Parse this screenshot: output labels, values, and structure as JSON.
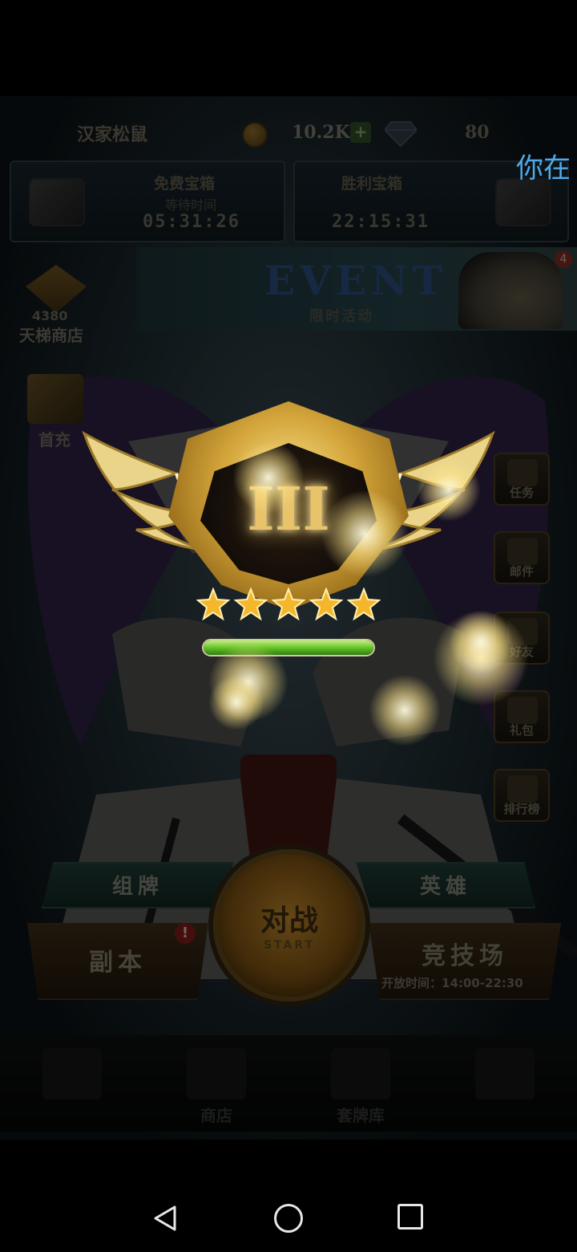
{
  "top_bar": {
    "player_name": "汉家松鼠",
    "coins": "10.2K",
    "add_label": "+",
    "gems": "80"
  },
  "notice": "你在",
  "chests": {
    "free": {
      "title": "免费宝箱",
      "subtitle": "等待时间",
      "time": "05:31:26"
    },
    "victory": {
      "title": "胜利宝箱",
      "time": "22:15:31"
    }
  },
  "event": {
    "title": "EVENT",
    "subtitle": "限时活动",
    "badge": "4"
  },
  "left_menu": {
    "ladder_count": "4380",
    "ladder_label": "天梯商店",
    "first_recharge_label": "首充"
  },
  "rank": {
    "numeral": "III",
    "stars_filled": 5,
    "stars_total": 5,
    "progress": 1.0,
    "progress_color": "#58b81e"
  },
  "right_menu": [
    {
      "label": "任务",
      "icon": "task-icon"
    },
    {
      "label": "邮件",
      "icon": "mail-icon"
    },
    {
      "label": "好友",
      "icon": "friends-icon"
    },
    {
      "label": "礼包",
      "icon": "gift-pack-icon"
    },
    {
      "label": "排行榜",
      "icon": "trophy-icon"
    }
  ],
  "controls": {
    "deck": "组牌",
    "hero": "英雄",
    "battle": "对战",
    "battle_sub": "START",
    "dungeon": "副本",
    "dungeon_alert": "!",
    "arena": "竞技场",
    "arena_time": "开放时间：14:00-22:30"
  },
  "bottom_nav": [
    {
      "label": "",
      "icon": "battle-swords-icon"
    },
    {
      "label": "商店",
      "icon": "scales-icon"
    },
    {
      "label": "套牌库",
      "icon": "cards-icon"
    },
    {
      "label": "",
      "icon": "blank-icon"
    }
  ],
  "colors": {
    "notice": "#4fa8e8",
    "gold": "#d3a43a",
    "progress": "#58b81e"
  }
}
